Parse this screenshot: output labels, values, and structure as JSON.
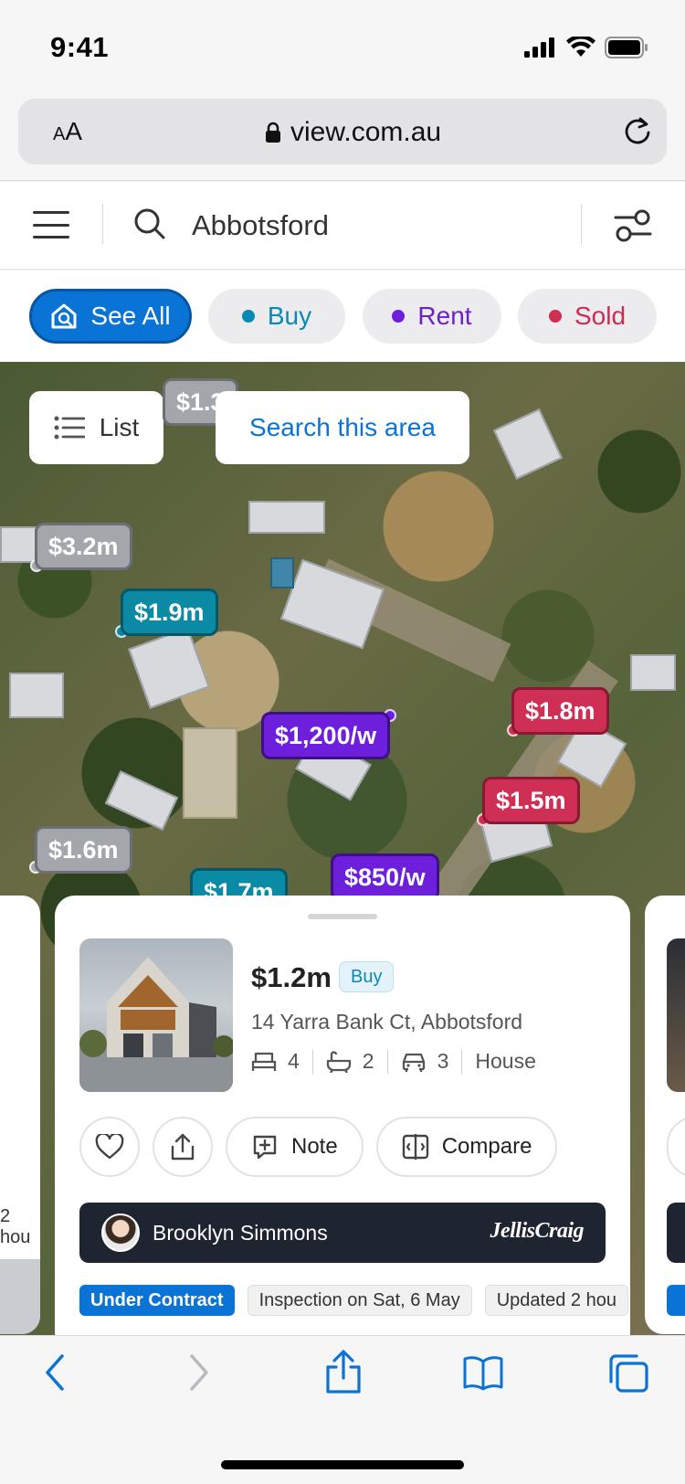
{
  "status_bar": {
    "time": "9:41"
  },
  "browser": {
    "aa_label_small": "A",
    "aa_label_large": "A",
    "url": "view.com.au"
  },
  "header": {
    "search_value": "Abbotsford"
  },
  "filters": {
    "see_all": "See All",
    "buy": "Buy",
    "rent": "Rent",
    "sold": "Sold"
  },
  "colors": {
    "brand_blue": "#0a73d6",
    "buy": "#0a8ab2",
    "rent": "#6d1fdc",
    "sold": "#cf2e55",
    "neutral": "#a3a6aa"
  },
  "map": {
    "list_button": "List",
    "search_area_button": "Search this area",
    "markers": [
      {
        "label": "$1.3",
        "status": "neutral"
      },
      {
        "label": "$3.2m",
        "status": "neutral"
      },
      {
        "label": "$1.9m",
        "status": "buy"
      },
      {
        "label": "$1,200/w",
        "status": "rent"
      },
      {
        "label": "$1.8m",
        "status": "sold"
      },
      {
        "label": "$1.5m",
        "status": "sold"
      },
      {
        "label": "$1.6m",
        "status": "neutral"
      },
      {
        "label": "$1.7m",
        "status": "buy"
      },
      {
        "label": "$850/w",
        "status": "rent"
      }
    ]
  },
  "listing": {
    "price": "$1.2m",
    "type_badge": "Buy",
    "address": "14 Yarra Bank Ct, Abbotsford",
    "beds": "4",
    "baths": "2",
    "cars": "3",
    "property_type": "House",
    "note_label": "Note",
    "compare_label": "Compare",
    "agent_name": "Brooklyn Simmons",
    "agency": "JellisCraig",
    "tags": [
      "Under Contract",
      "Inspection on Sat, 6 May",
      "Updated 2 hou"
    ]
  },
  "side_cards": {
    "left_tag": "2 hou"
  }
}
